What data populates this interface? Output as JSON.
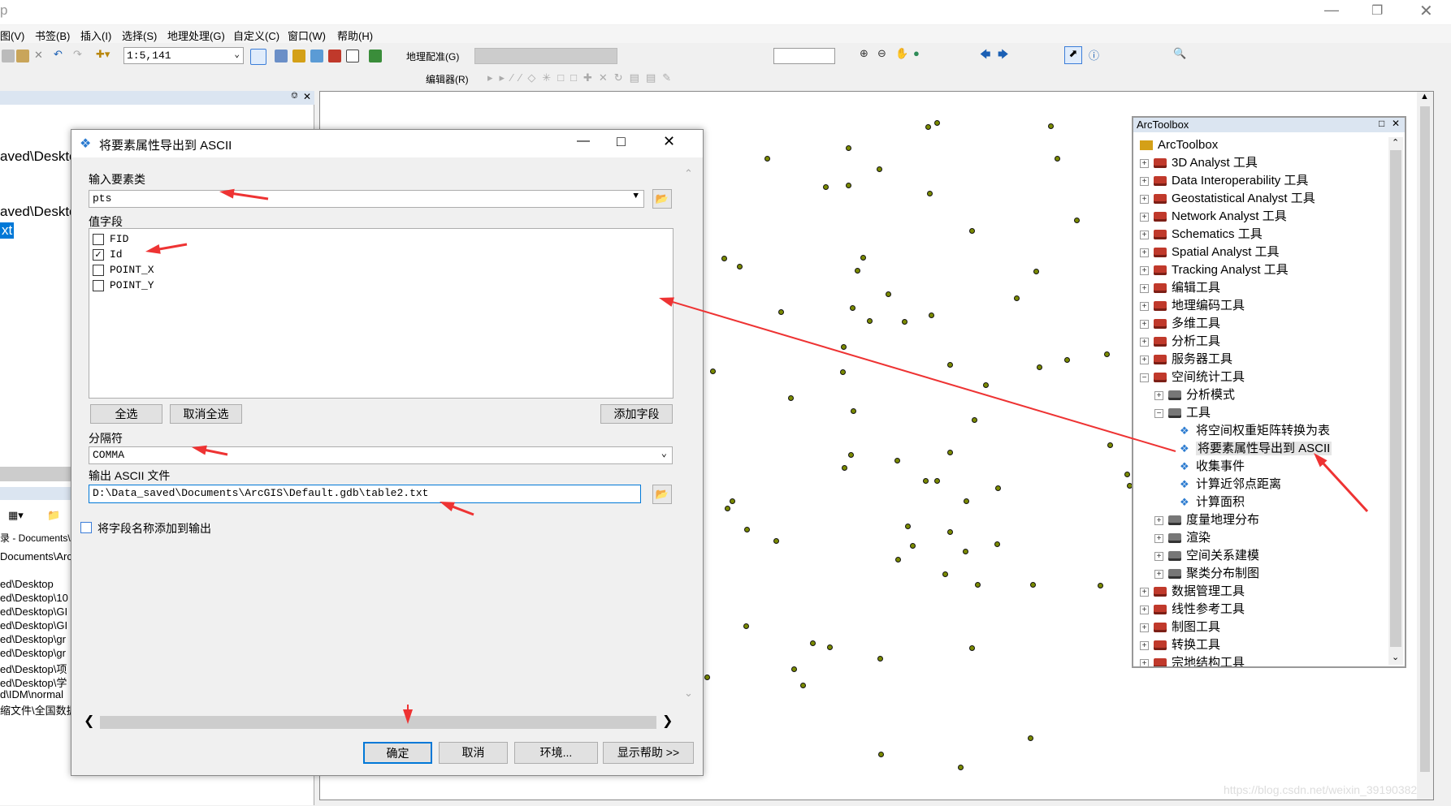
{
  "app": {
    "title_fragment": "p",
    "menu": [
      "图(V)",
      "书签(B)",
      "插入(I)",
      "选择(S)",
      "地理处理(G)",
      "自定义(C)",
      "窗口(W)",
      "帮助(H)"
    ],
    "scale": "1:5,141",
    "georef_label": "地理配准(G)",
    "editor_label": "编辑器(R)"
  },
  "left_panel": {
    "lines": [
      "aved\\Deskto",
      "aved\\Deskto",
      "xt"
    ],
    "catalog": {
      "path1": "录 - Documents\\A",
      "path2": "Documents\\Arc",
      "items": [
        "ed\\Desktop",
        "ed\\Desktop\\10",
        "ed\\Desktop\\GI",
        "ed\\Desktop\\GI",
        "ed\\Desktop\\gr",
        "ed\\Desktop\\gr",
        "ed\\Desktop\\项",
        "ed\\Desktop\\学",
        "d\\IDM\\normal",
        "缩文件\\全国数据"
      ]
    }
  },
  "dialog": {
    "title": "将要素属性导出到 ASCII",
    "input_label": "输入要素类",
    "input_value": "pts",
    "fields_label": "值字段",
    "fields": [
      {
        "name": "FID",
        "checked": false
      },
      {
        "name": "Id",
        "checked": true
      },
      {
        "name": "POINT_X",
        "checked": false
      },
      {
        "name": "POINT_Y",
        "checked": false
      }
    ],
    "select_all": "全选",
    "deselect_all": "取消全选",
    "add_field": "添加字段",
    "delimiter_label": "分隔符",
    "delimiter_value": "COMMA",
    "output_label": "输出 ASCII 文件",
    "output_value": "D:\\Data_saved\\Documents\\ArcGIS\\Default.gdb\\table2.txt",
    "add_names_label": "将字段名称添加到输出",
    "add_names_checked": false,
    "ok": "确定",
    "cancel": "取消",
    "env": "环境...",
    "help": "显示帮助 >>"
  },
  "toolbox": {
    "title": "ArcToolbox",
    "root": "ArcToolbox",
    "items": [
      {
        "label": "3D Analyst 工具",
        "level": 1,
        "type": "box",
        "state": "+"
      },
      {
        "label": "Data Interoperability 工具",
        "level": 1,
        "type": "box",
        "state": "+"
      },
      {
        "label": "Geostatistical Analyst 工具",
        "level": 1,
        "type": "box",
        "state": "+"
      },
      {
        "label": "Network Analyst 工具",
        "level": 1,
        "type": "box",
        "state": "+"
      },
      {
        "label": "Schematics 工具",
        "level": 1,
        "type": "box",
        "state": "+"
      },
      {
        "label": "Spatial Analyst 工具",
        "level": 1,
        "type": "box",
        "state": "+"
      },
      {
        "label": "Tracking Analyst 工具",
        "level": 1,
        "type": "box",
        "state": "+"
      },
      {
        "label": "编辑工具",
        "level": 1,
        "type": "box",
        "state": "+"
      },
      {
        "label": "地理编码工具",
        "level": 1,
        "type": "box",
        "state": "+"
      },
      {
        "label": "多维工具",
        "level": 1,
        "type": "box",
        "state": "+"
      },
      {
        "label": "分析工具",
        "level": 1,
        "type": "box",
        "state": "+"
      },
      {
        "label": "服务器工具",
        "level": 1,
        "type": "box",
        "state": "+"
      },
      {
        "label": "空间统计工具",
        "level": 1,
        "type": "box",
        "state": "-"
      },
      {
        "label": "分析模式",
        "level": 2,
        "type": "set",
        "state": "+"
      },
      {
        "label": "工具",
        "level": 2,
        "type": "set",
        "state": "-"
      },
      {
        "label": "将空间权重矩阵转换为表",
        "level": 3,
        "type": "tool"
      },
      {
        "label": "将要素属性导出到 ASCII",
        "level": 3,
        "type": "tool",
        "selected": true
      },
      {
        "label": "收集事件",
        "level": 3,
        "type": "tool"
      },
      {
        "label": "计算近邻点距离",
        "level": 3,
        "type": "tool"
      },
      {
        "label": "计算面积",
        "level": 3,
        "type": "tool"
      },
      {
        "label": "度量地理分布",
        "level": 2,
        "type": "set",
        "state": "+"
      },
      {
        "label": "渲染",
        "level": 2,
        "type": "set",
        "state": "+"
      },
      {
        "label": "空间关系建模",
        "level": 2,
        "type": "set",
        "state": "+"
      },
      {
        "label": "聚类分布制图",
        "level": 2,
        "type": "set",
        "state": "+"
      },
      {
        "label": "数据管理工具",
        "level": 1,
        "type": "box",
        "state": "+"
      },
      {
        "label": "线性参考工具",
        "level": 1,
        "type": "box",
        "state": "+"
      },
      {
        "label": "制图工具",
        "level": 1,
        "type": "box",
        "state": "+"
      },
      {
        "label": "转换工具",
        "level": 1,
        "type": "box",
        "state": "+"
      },
      {
        "label": "宗地结构工具",
        "level": 1,
        "type": "box",
        "state": "+"
      }
    ]
  },
  "watermark": "https://blog.csdn.net/weixin_39190382",
  "colors": {
    "arrow": "#ee3333",
    "selection": "#0078d7",
    "point_fill": "#7a8a00"
  }
}
